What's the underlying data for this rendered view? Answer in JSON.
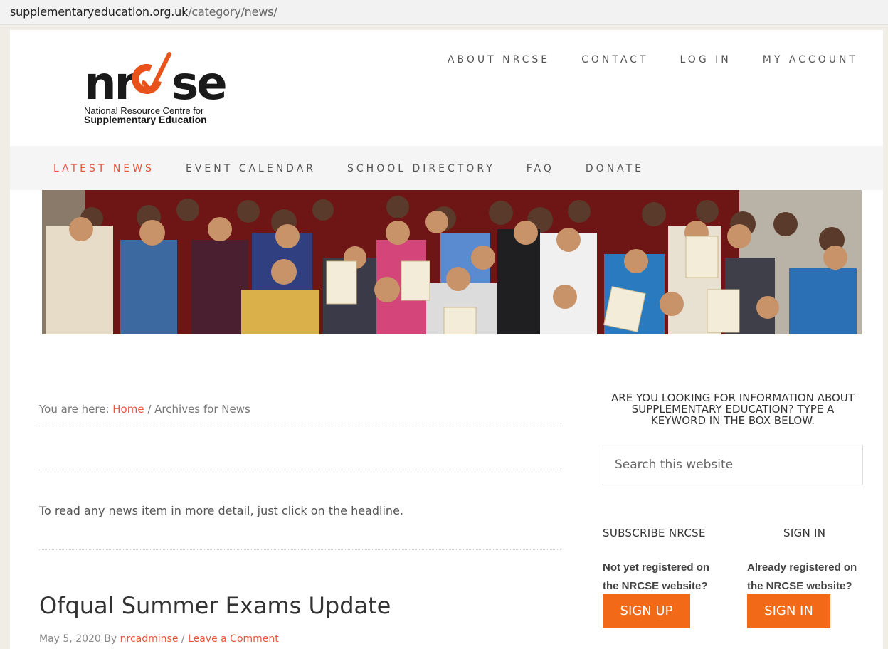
{
  "browser": {
    "url_domain": "supplementaryeducation.org.uk",
    "url_path": "/category/news/"
  },
  "logo": {
    "word_part1": "nr",
    "word_part2": "se",
    "subtitle_line1": "National Resource Centre for",
    "subtitle_line2": "Supplementary Education"
  },
  "colors": {
    "accent": "#e8553c",
    "button": "#f26a17",
    "hero_background": "#6b1515"
  },
  "top_nav": {
    "items": [
      {
        "label": "ABOUT NRCSE"
      },
      {
        "label": "CONTACT"
      },
      {
        "label": "LOG IN"
      },
      {
        "label": "MY ACCOUNT"
      }
    ]
  },
  "main_nav": {
    "items": [
      {
        "label": "LATEST NEWS",
        "active": true
      },
      {
        "label": "EVENT CALENDAR"
      },
      {
        "label": "SCHOOL DIRECTORY"
      },
      {
        "label": "FAQ"
      },
      {
        "label": "DONATE"
      }
    ]
  },
  "breadcrumb": {
    "prefix": "You are here: ",
    "home": "Home",
    "separator": " / ",
    "current": "Archives for News"
  },
  "content": {
    "intro": "To read any news item in more detail, just click on the headline."
  },
  "post": {
    "title": "Ofqual Summer Exams Update",
    "date": "May 5, 2020",
    "by": " By ",
    "author": "nrcadminse",
    "separator": " / ",
    "comment_link": "Leave a Comment"
  },
  "sidebar": {
    "heading": "ARE YOU LOOKING FOR INFORMATION ABOUT SUPPLEMENTARY EDUCATION? TYPE A KEYWORD IN THE BOX BELOW.",
    "search_placeholder": "Search this website",
    "subscribe": {
      "title": "SUBSCRIBE NRCSE",
      "text": "Not yet registered on the NRCSE website?",
      "button": "SIGN UP"
    },
    "signin": {
      "title": "SIGN IN",
      "text": "Already registered on the NRCSE website?",
      "button": "SIGN IN"
    }
  }
}
